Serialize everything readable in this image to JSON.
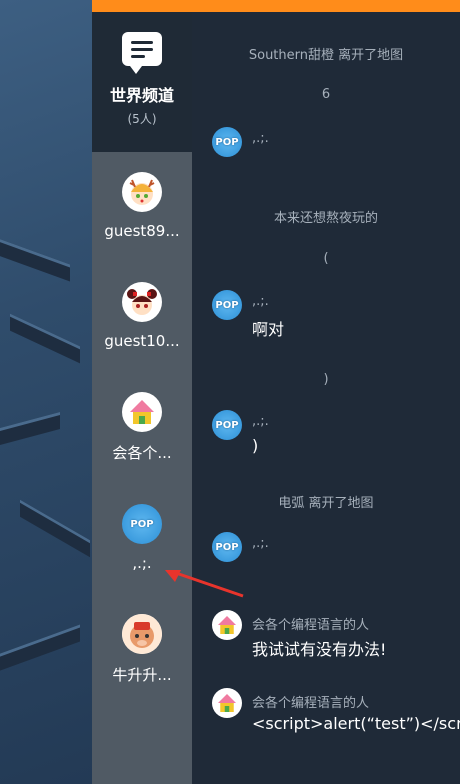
{
  "channel": {
    "title": "世界频道",
    "count": "(5人)"
  },
  "users": [
    {
      "name": "guest89...",
      "avatar": "girl-antlers-avatar"
    },
    {
      "name": "guest10...",
      "avatar": "girl-bun-avatar"
    },
    {
      "name": "会各个...",
      "avatar": "house-avatar"
    },
    {
      "name": ",.;.",
      "avatar": "pop-avatar"
    },
    {
      "name": "牛升升...",
      "avatar": "bull-avatar"
    }
  ],
  "messages": [
    {
      "kind": "system",
      "text": "Southern甜橙 离开了地图"
    },
    {
      "kind": "system",
      "text": "6"
    },
    {
      "kind": "chat",
      "sender": ",.;.",
      "text": "",
      "avatar": "pop-avatar"
    },
    {
      "kind": "system",
      "text": "本来还想熬夜玩的"
    },
    {
      "kind": "system",
      "text": "("
    },
    {
      "kind": "chat",
      "sender": ",.;.",
      "text": "啊对",
      "avatar": "pop-avatar"
    },
    {
      "kind": "system",
      "text": ")"
    },
    {
      "kind": "chat",
      "sender": ",.;.",
      "text": ")",
      "avatar": "pop-avatar"
    },
    {
      "kind": "system",
      "text": "电弧 离开了地图"
    },
    {
      "kind": "chat",
      "sender": ",.;.",
      "text": "",
      "avatar": "pop-avatar"
    },
    {
      "kind": "chat",
      "sender": "会各个编程语言的人",
      "text": "我试试有没有办法!",
      "avatar": "house-avatar"
    },
    {
      "kind": "chat",
      "sender": "会各个编程语言的人",
      "text": "<script>alert(“test”)</scr",
      "avatar": "house-avatar"
    }
  ],
  "avatar_text": {
    "pop": "POP"
  },
  "colors": {
    "accent": "#ff8c1a",
    "arrow": "#e8342c"
  }
}
